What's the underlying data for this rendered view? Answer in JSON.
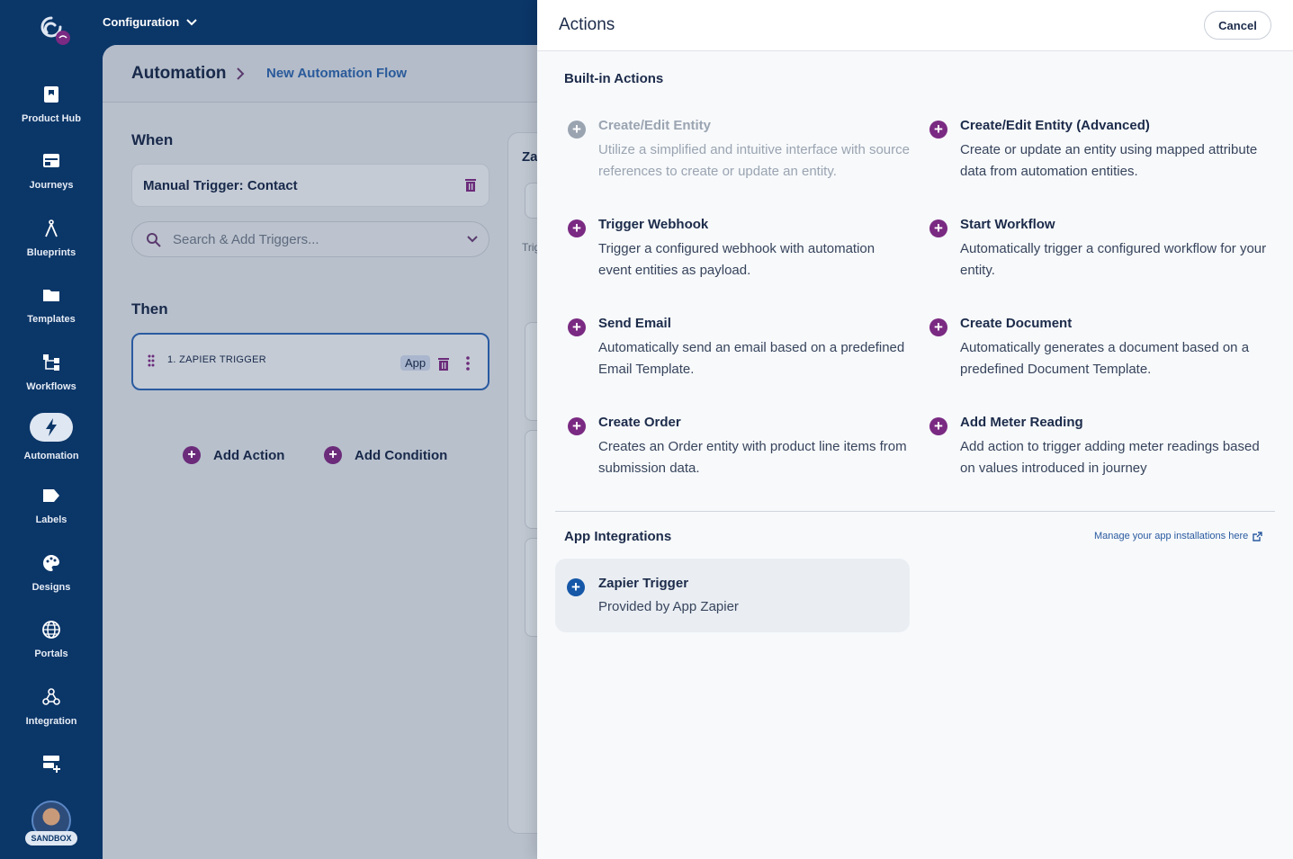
{
  "topbar": {
    "config_label": "Configuration"
  },
  "sidebar": {
    "items": [
      {
        "label": "Product Hub",
        "icon": "product-hub-icon"
      },
      {
        "label": "Journeys",
        "icon": "journeys-icon"
      },
      {
        "label": "Blueprints",
        "icon": "blueprints-icon"
      },
      {
        "label": "Templates",
        "icon": "folder-icon"
      },
      {
        "label": "Workflows",
        "icon": "workflows-icon"
      },
      {
        "label": "Automation",
        "icon": "lightning-icon",
        "active": true
      },
      {
        "label": "Labels",
        "icon": "label-icon"
      },
      {
        "label": "Designs",
        "icon": "palette-icon"
      },
      {
        "label": "Portals",
        "icon": "globe-icon"
      },
      {
        "label": "Integration",
        "icon": "webhook-icon"
      },
      {
        "label": "",
        "icon": "entity-manager-icon"
      }
    ],
    "user_badge": "SANDBOX"
  },
  "main": {
    "breadcrumb": {
      "root": "Automation",
      "current": "New Automation Flow"
    },
    "when_heading": "When",
    "trigger_title": "Manual Trigger: Contact",
    "search": {
      "placeholder": "Search & Add Triggers..."
    },
    "then_heading": "Then",
    "action_item": {
      "label": "1. ZAPIER TRIGGER",
      "badge": "App"
    },
    "add_action": "Add Action",
    "add_condition": "Add Condition",
    "side_panel": {
      "title_fragment": "Za",
      "sub_fragment": "Trig"
    }
  },
  "actions_panel": {
    "title": "Actions",
    "cancel_label": "Cancel",
    "builtin_heading": "Built-in Actions",
    "builtin": [
      {
        "name": "Create/Edit Entity",
        "desc": "Utilize a simplified and intuitive interface with source references to create or update an entity.",
        "disabled": true
      },
      {
        "name": "Create/Edit Entity (Advanced)",
        "desc": "Create or update an entity using mapped attribute data from automation entities.",
        "disabled": false
      },
      {
        "name": "Trigger Webhook",
        "desc": "Trigger a configured webhook with automation event entities as payload.",
        "disabled": false
      },
      {
        "name": "Start Workflow",
        "desc": "Automatically trigger a configured workflow for your entity.",
        "disabled": false
      },
      {
        "name": "Send Email",
        "desc": "Automatically send an email based on a predefined Email Template.",
        "disabled": false
      },
      {
        "name": "Create Document",
        "desc": "Automatically generates a document based on a predefined Document Template.",
        "disabled": false
      },
      {
        "name": "Create Order",
        "desc": "Creates an Order entity with product line items from submission data.",
        "disabled": false
      },
      {
        "name": "Add Meter Reading",
        "desc": "Add action to trigger adding meter readings based on values introduced in journey",
        "disabled": false
      }
    ],
    "app_heading": "App Integrations",
    "manage_link": "Manage your app installations here",
    "apps": [
      {
        "name": "Zapier Trigger",
        "desc": "Provided by App Zapier"
      }
    ]
  },
  "colors": {
    "sidebar_bg": "#0b3668",
    "accent_purple": "#7a2a82",
    "accent_blue": "#1657a8"
  }
}
